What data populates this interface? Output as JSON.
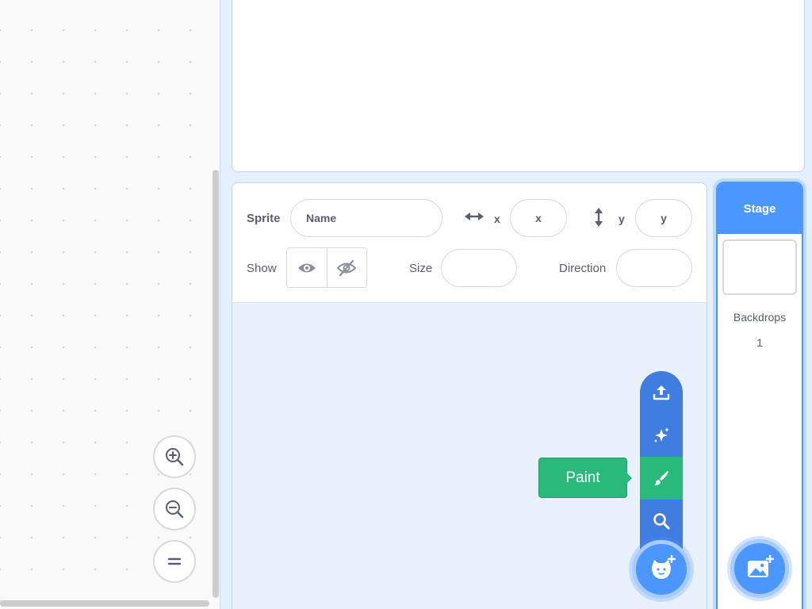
{
  "sprite_info": {
    "sprite_label": "Sprite",
    "name_placeholder": "Name",
    "x_label": "x",
    "x_placeholder": "x",
    "y_label": "y",
    "y_placeholder": "y",
    "show_label": "Show",
    "size_label": "Size",
    "direction_label": "Direction"
  },
  "sprite_menu": {
    "items": [
      "upload-icon",
      "surprise-icon",
      "paint-icon",
      "search-icon"
    ],
    "active_item": "paint-icon",
    "tooltip": "Paint",
    "fab_icon": "choose-sprite-icon"
  },
  "stage_selector": {
    "header": "Stage",
    "backdrops_label": "Backdrops",
    "backdrops_count": "1",
    "fab_icon": "choose-backdrop-icon"
  },
  "workspace": {
    "zoom_controls": [
      "zoom-in-icon",
      "zoom-out-icon",
      "zoom-reset-icon"
    ]
  },
  "colors": {
    "accent": "#4c97ff",
    "menu_blue": "#3f7de0",
    "paint_green": "#29b97a",
    "text": "#575e75",
    "pane_bg": "#e9f1fc"
  }
}
